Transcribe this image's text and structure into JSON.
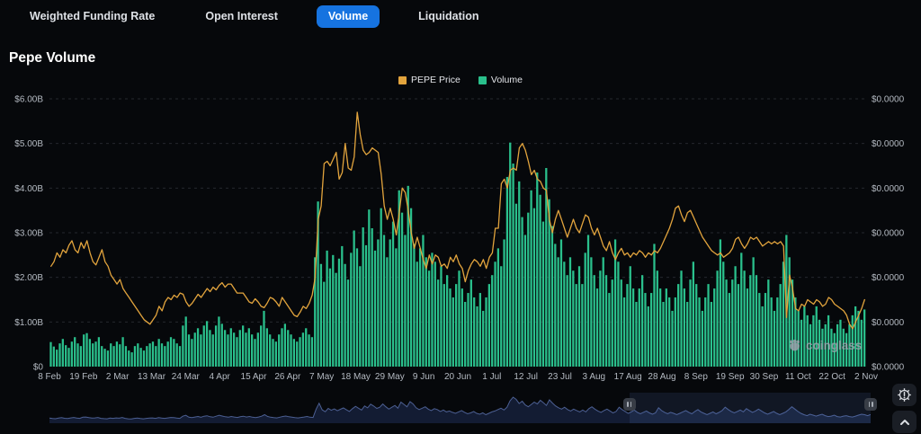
{
  "page": {
    "title": "Pepe Volume"
  },
  "tabs": {
    "items": [
      {
        "label": "Weighted Funding Rate",
        "active": false
      },
      {
        "label": "Open Interest",
        "active": false
      },
      {
        "label": "Volume",
        "active": true
      },
      {
        "label": "Liquidation",
        "active": false
      }
    ]
  },
  "legend": {
    "items": [
      {
        "label": "PEPE Price",
        "color": "#E2A43D"
      },
      {
        "label": "Volume",
        "color": "#2AC08C"
      }
    ]
  },
  "colors": {
    "accent": "#1673E0",
    "price_line": "#E2A43D",
    "volume_bar": "#2AC08C",
    "axis_text": "#B4BAC2",
    "grid_line": "#24272E",
    "nav_fill": "#131C33",
    "nav_stroke": "#4C5F92"
  },
  "watermark": {
    "text": "coinglass"
  },
  "navigator": {
    "selection_start_frac": 0.706,
    "selection_end_frac": 1.0
  },
  "chart_data": {
    "type": "combo",
    "title": "Pepe Volume",
    "grid": "horizontal dashed",
    "legend_position": "top-center",
    "left_axis": {
      "unit": "USD volume (billions)",
      "min": 0,
      "max": 6,
      "labels": [
        "$6.00B",
        "$5.00B",
        "$4.00B",
        "$3.00B",
        "$2.00B",
        "$1.00B",
        "$0"
      ]
    },
    "right_axis": {
      "unit": "PEPE price (USD, rounds to $0.0000 at 4 decimals)",
      "labels": [
        "$0.0000",
        "$0.0000",
        "$0.0000",
        "$0.0000",
        "$0.0000",
        "$0.0000",
        "$0.0000"
      ]
    },
    "x_tick_labels": [
      "8 Feb",
      "19 Feb",
      "2 Mar",
      "13 Mar",
      "24 Mar",
      "4 Apr",
      "15 Apr",
      "26 Apr",
      "7 May",
      "18 May",
      "29 May",
      "9 Jun",
      "20 Jun",
      "1 Jul",
      "12 Jul",
      "23 Jul",
      "3 Aug",
      "17 Aug",
      "28 Aug",
      "8 Sep",
      "19 Sep",
      "30 Sep",
      "11 Oct",
      "22 Oct",
      "2 Nov"
    ],
    "series": [
      {
        "name": "Volume",
        "type": "bar",
        "axis": "left",
        "unit": "$B",
        "color": "#2AC08C",
        "values": [
          0.55,
          0.45,
          0.38,
          0.52,
          0.62,
          0.48,
          0.42,
          0.56,
          0.66,
          0.52,
          0.46,
          0.72,
          0.75,
          0.62,
          0.52,
          0.56,
          0.66,
          0.46,
          0.4,
          0.36,
          0.52,
          0.46,
          0.56,
          0.5,
          0.66,
          0.46,
          0.36,
          0.32,
          0.46,
          0.52,
          0.42,
          0.36,
          0.46,
          0.52,
          0.56,
          0.46,
          0.62,
          0.52,
          0.46,
          0.56,
          0.66,
          0.62,
          0.52,
          0.46,
          0.92,
          1.12,
          0.72,
          0.62,
          0.76,
          0.86,
          0.72,
          0.92,
          1.02,
          0.82,
          0.72,
          0.92,
          1.12,
          0.96,
          0.82,
          0.72,
          0.86,
          0.76,
          0.66,
          0.82,
          0.92,
          0.76,
          0.86,
          0.72,
          0.62,
          0.76,
          0.92,
          1.25,
          0.86,
          0.72,
          0.62,
          0.56,
          0.72,
          0.86,
          0.96,
          0.82,
          0.72,
          0.62,
          0.56,
          0.66,
          0.76,
          0.86,
          0.72,
          0.66,
          2.45,
          3.7,
          2.3,
          1.9,
          2.6,
          2.2,
          2.5,
          2.1,
          2.42,
          2.7,
          2.3,
          1.95,
          2.55,
          3.05,
          2.65,
          2.25,
          3.12,
          2.72,
          3.52,
          3.1,
          2.6,
          2.85,
          3.55,
          2.95,
          2.45,
          2.85,
          3.25,
          2.65,
          3.95,
          3.45,
          2.95,
          4.05,
          3.55,
          2.75,
          2.35,
          2.65,
          2.95,
          2.45,
          2.15,
          2.55,
          2.35,
          1.95,
          2.25,
          1.85,
          2.05,
          1.75,
          1.55,
          1.85,
          2.15,
          1.75,
          1.45,
          1.65,
          1.95,
          1.55,
          1.35,
          1.65,
          1.25,
          1.55,
          1.85,
          2.05,
          2.35,
          2.65,
          2.25,
          2.85,
          4.25,
          5.02,
          4.55,
          3.65,
          4.15,
          3.35,
          2.95,
          3.45,
          3.95,
          3.55,
          4.35,
          3.85,
          3.25,
          4.45,
          3.75,
          3.15,
          2.75,
          2.45,
          2.85,
          2.35,
          2.05,
          2.45,
          2.15,
          1.85,
          2.25,
          1.85,
          2.55,
          2.95,
          2.45,
          2.05,
          1.75,
          2.15,
          2.45,
          2.05,
          1.65,
          1.95,
          2.85,
          2.35,
          1.95,
          1.55,
          1.85,
          2.25,
          1.75,
          1.45,
          1.75,
          2.05,
          1.65,
          1.35,
          1.65,
          2.75,
          2.15,
          1.75,
          1.45,
          1.75,
          1.55,
          1.25,
          1.55,
          1.85,
          2.15,
          1.75,
          1.45,
          1.95,
          2.35,
          1.85,
          1.55,
          1.25,
          1.55,
          1.85,
          1.45,
          1.75,
          2.15,
          2.85,
          2.35,
          1.95,
          1.65,
          1.95,
          2.25,
          1.85,
          2.55,
          2.15,
          1.75,
          2.05,
          2.45,
          2.05,
          1.65,
          1.35,
          1.65,
          1.95,
          1.55,
          1.25,
          1.55,
          1.85,
          2.35,
          2.95,
          2.45,
          1.95,
          1.55,
          1.25,
          1.05,
          1.35,
          1.15,
          0.95,
          1.15,
          1.35,
          1.05,
          0.85,
          0.95,
          1.15,
          0.85,
          0.75,
          0.95,
          1.05,
          0.85,
          0.75,
          0.95,
          1.15,
          1.35,
          1.25,
          1.05,
          1.28
        ]
      },
      {
        "name": "PEPE Price",
        "type": "line",
        "axis": "right",
        "note": "right-axis tick labels all display $0.0000; values below are plot heights expressed in left-axis $B equivalents",
        "color": "#E2A43D",
        "values": [
          2.25,
          2.35,
          2.55,
          2.45,
          2.62,
          2.55,
          2.72,
          2.82,
          2.62,
          2.55,
          2.78,
          2.65,
          2.82,
          2.55,
          2.35,
          2.28,
          2.45,
          2.62,
          2.35,
          2.25,
          2.05,
          1.95,
          1.85,
          1.95,
          1.75,
          1.65,
          1.55,
          1.45,
          1.35,
          1.25,
          1.15,
          1.05,
          1.0,
          0.95,
          1.05,
          1.15,
          1.35,
          1.25,
          1.45,
          1.55,
          1.5,
          1.6,
          1.55,
          1.65,
          1.62,
          1.45,
          1.35,
          1.42,
          1.52,
          1.62,
          1.55,
          1.65,
          1.75,
          1.68,
          1.78,
          1.72,
          1.82,
          1.88,
          1.78,
          1.85,
          1.85,
          1.75,
          1.65,
          1.65,
          1.65,
          1.55,
          1.45,
          1.42,
          1.52,
          1.45,
          1.35,
          1.32,
          1.42,
          1.55,
          1.52,
          1.45,
          1.35,
          1.55,
          1.45,
          1.35,
          1.25,
          1.15,
          1.12,
          1.22,
          1.35,
          1.3,
          1.42,
          1.6,
          2.0,
          3.3,
          3.6,
          4.55,
          4.6,
          4.5,
          4.65,
          4.8,
          4.2,
          4.35,
          5.0,
          4.45,
          4.4,
          4.7,
          5.7,
          5.2,
          4.85,
          4.75,
          4.8,
          4.9,
          4.85,
          4.8,
          4.3,
          3.6,
          3.3,
          3.55,
          3.3,
          2.95,
          3.45,
          4.0,
          3.9,
          3.5,
          3.0,
          2.65,
          2.9,
          2.65,
          2.4,
          2.2,
          2.5,
          2.3,
          2.5,
          2.45,
          2.25,
          2.3,
          2.2,
          2.45,
          2.35,
          2.5,
          2.3,
          2.2,
          1.9,
          2.15,
          2.3,
          2.4,
          2.35,
          2.25,
          2.4,
          2.2,
          2.45,
          2.55,
          3.1,
          3.1,
          4.1,
          4.2,
          4.0,
          4.4,
          4.45,
          4.4,
          4.9,
          5.0,
          4.85,
          4.6,
          4.3,
          4.4,
          4.2,
          4.15,
          4.0,
          3.95,
          3.3,
          3.0,
          3.3,
          3.5,
          3.3,
          3.1,
          2.9,
          3.1,
          3.3,
          3.1,
          3.0,
          3.2,
          3.4,
          3.35,
          3.1,
          2.95,
          3.1,
          2.9,
          2.7,
          2.6,
          2.8,
          2.55,
          2.4,
          2.55,
          2.65,
          2.5,
          2.55,
          2.45,
          2.55,
          2.5,
          2.6,
          2.55,
          2.45,
          2.55,
          2.5,
          2.6,
          2.55,
          2.65,
          2.8,
          2.95,
          3.1,
          3.3,
          3.55,
          3.6,
          3.4,
          3.25,
          3.45,
          3.5,
          3.35,
          3.2,
          3.05,
          2.9,
          2.8,
          2.7,
          2.6,
          2.55,
          2.5,
          2.55,
          2.45,
          2.5,
          2.55,
          2.65,
          2.85,
          2.9,
          2.75,
          2.65,
          2.75,
          2.9,
          2.85,
          2.9,
          2.8,
          2.7,
          2.75,
          2.8,
          2.75,
          2.8,
          2.75,
          2.8,
          2.7,
          1.1,
          2.05,
          1.75,
          1.3,
          1.25,
          1.4,
          1.35,
          1.5,
          1.45,
          1.4,
          1.5,
          1.45,
          1.35,
          1.4,
          1.55,
          1.5,
          1.4,
          1.35,
          1.3,
          1.25,
          1.15,
          0.95,
          0.85,
          1.0,
          1.15,
          1.3,
          1.5
        ]
      }
    ]
  }
}
